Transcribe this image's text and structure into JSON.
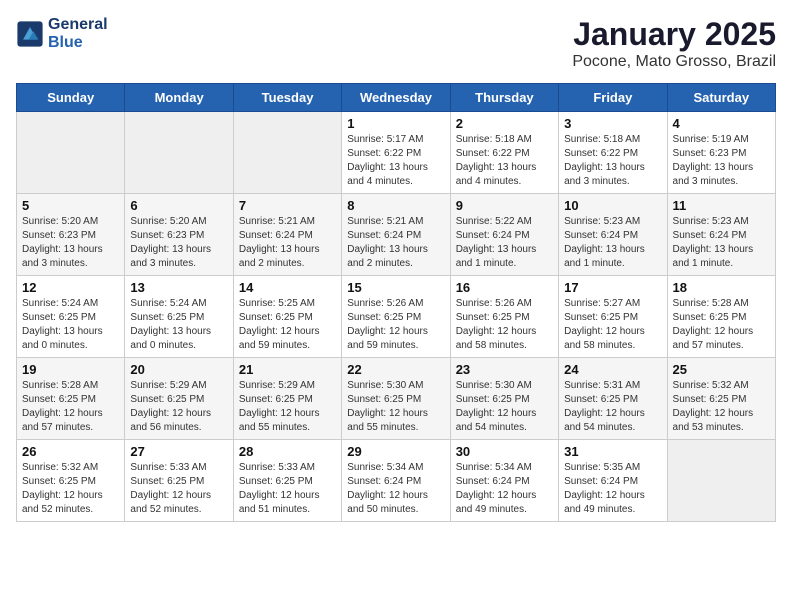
{
  "header": {
    "logo_line1": "General",
    "logo_line2": "Blue",
    "month": "January 2025",
    "location": "Pocone, Mato Grosso, Brazil"
  },
  "weekdays": [
    "Sunday",
    "Monday",
    "Tuesday",
    "Wednesday",
    "Thursday",
    "Friday",
    "Saturday"
  ],
  "weeks": [
    [
      {
        "day": "",
        "info": ""
      },
      {
        "day": "",
        "info": ""
      },
      {
        "day": "",
        "info": ""
      },
      {
        "day": "1",
        "info": "Sunrise: 5:17 AM\nSunset: 6:22 PM\nDaylight: 13 hours and 4 minutes."
      },
      {
        "day": "2",
        "info": "Sunrise: 5:18 AM\nSunset: 6:22 PM\nDaylight: 13 hours and 4 minutes."
      },
      {
        "day": "3",
        "info": "Sunrise: 5:18 AM\nSunset: 6:22 PM\nDaylight: 13 hours and 3 minutes."
      },
      {
        "day": "4",
        "info": "Sunrise: 5:19 AM\nSunset: 6:23 PM\nDaylight: 13 hours and 3 minutes."
      }
    ],
    [
      {
        "day": "5",
        "info": "Sunrise: 5:20 AM\nSunset: 6:23 PM\nDaylight: 13 hours and 3 minutes."
      },
      {
        "day": "6",
        "info": "Sunrise: 5:20 AM\nSunset: 6:23 PM\nDaylight: 13 hours and 3 minutes."
      },
      {
        "day": "7",
        "info": "Sunrise: 5:21 AM\nSunset: 6:24 PM\nDaylight: 13 hours and 2 minutes."
      },
      {
        "day": "8",
        "info": "Sunrise: 5:21 AM\nSunset: 6:24 PM\nDaylight: 13 hours and 2 minutes."
      },
      {
        "day": "9",
        "info": "Sunrise: 5:22 AM\nSunset: 6:24 PM\nDaylight: 13 hours and 1 minute."
      },
      {
        "day": "10",
        "info": "Sunrise: 5:23 AM\nSunset: 6:24 PM\nDaylight: 13 hours and 1 minute."
      },
      {
        "day": "11",
        "info": "Sunrise: 5:23 AM\nSunset: 6:24 PM\nDaylight: 13 hours and 1 minute."
      }
    ],
    [
      {
        "day": "12",
        "info": "Sunrise: 5:24 AM\nSunset: 6:25 PM\nDaylight: 13 hours and 0 minutes."
      },
      {
        "day": "13",
        "info": "Sunrise: 5:24 AM\nSunset: 6:25 PM\nDaylight: 13 hours and 0 minutes."
      },
      {
        "day": "14",
        "info": "Sunrise: 5:25 AM\nSunset: 6:25 PM\nDaylight: 12 hours and 59 minutes."
      },
      {
        "day": "15",
        "info": "Sunrise: 5:26 AM\nSunset: 6:25 PM\nDaylight: 12 hours and 59 minutes."
      },
      {
        "day": "16",
        "info": "Sunrise: 5:26 AM\nSunset: 6:25 PM\nDaylight: 12 hours and 58 minutes."
      },
      {
        "day": "17",
        "info": "Sunrise: 5:27 AM\nSunset: 6:25 PM\nDaylight: 12 hours and 58 minutes."
      },
      {
        "day": "18",
        "info": "Sunrise: 5:28 AM\nSunset: 6:25 PM\nDaylight: 12 hours and 57 minutes."
      }
    ],
    [
      {
        "day": "19",
        "info": "Sunrise: 5:28 AM\nSunset: 6:25 PM\nDaylight: 12 hours and 57 minutes."
      },
      {
        "day": "20",
        "info": "Sunrise: 5:29 AM\nSunset: 6:25 PM\nDaylight: 12 hours and 56 minutes."
      },
      {
        "day": "21",
        "info": "Sunrise: 5:29 AM\nSunset: 6:25 PM\nDaylight: 12 hours and 55 minutes."
      },
      {
        "day": "22",
        "info": "Sunrise: 5:30 AM\nSunset: 6:25 PM\nDaylight: 12 hours and 55 minutes."
      },
      {
        "day": "23",
        "info": "Sunrise: 5:30 AM\nSunset: 6:25 PM\nDaylight: 12 hours and 54 minutes."
      },
      {
        "day": "24",
        "info": "Sunrise: 5:31 AM\nSunset: 6:25 PM\nDaylight: 12 hours and 54 minutes."
      },
      {
        "day": "25",
        "info": "Sunrise: 5:32 AM\nSunset: 6:25 PM\nDaylight: 12 hours and 53 minutes."
      }
    ],
    [
      {
        "day": "26",
        "info": "Sunrise: 5:32 AM\nSunset: 6:25 PM\nDaylight: 12 hours and 52 minutes."
      },
      {
        "day": "27",
        "info": "Sunrise: 5:33 AM\nSunset: 6:25 PM\nDaylight: 12 hours and 52 minutes."
      },
      {
        "day": "28",
        "info": "Sunrise: 5:33 AM\nSunset: 6:25 PM\nDaylight: 12 hours and 51 minutes."
      },
      {
        "day": "29",
        "info": "Sunrise: 5:34 AM\nSunset: 6:24 PM\nDaylight: 12 hours and 50 minutes."
      },
      {
        "day": "30",
        "info": "Sunrise: 5:34 AM\nSunset: 6:24 PM\nDaylight: 12 hours and 49 minutes."
      },
      {
        "day": "31",
        "info": "Sunrise: 5:35 AM\nSunset: 6:24 PM\nDaylight: 12 hours and 49 minutes."
      },
      {
        "day": "",
        "info": ""
      }
    ]
  ]
}
